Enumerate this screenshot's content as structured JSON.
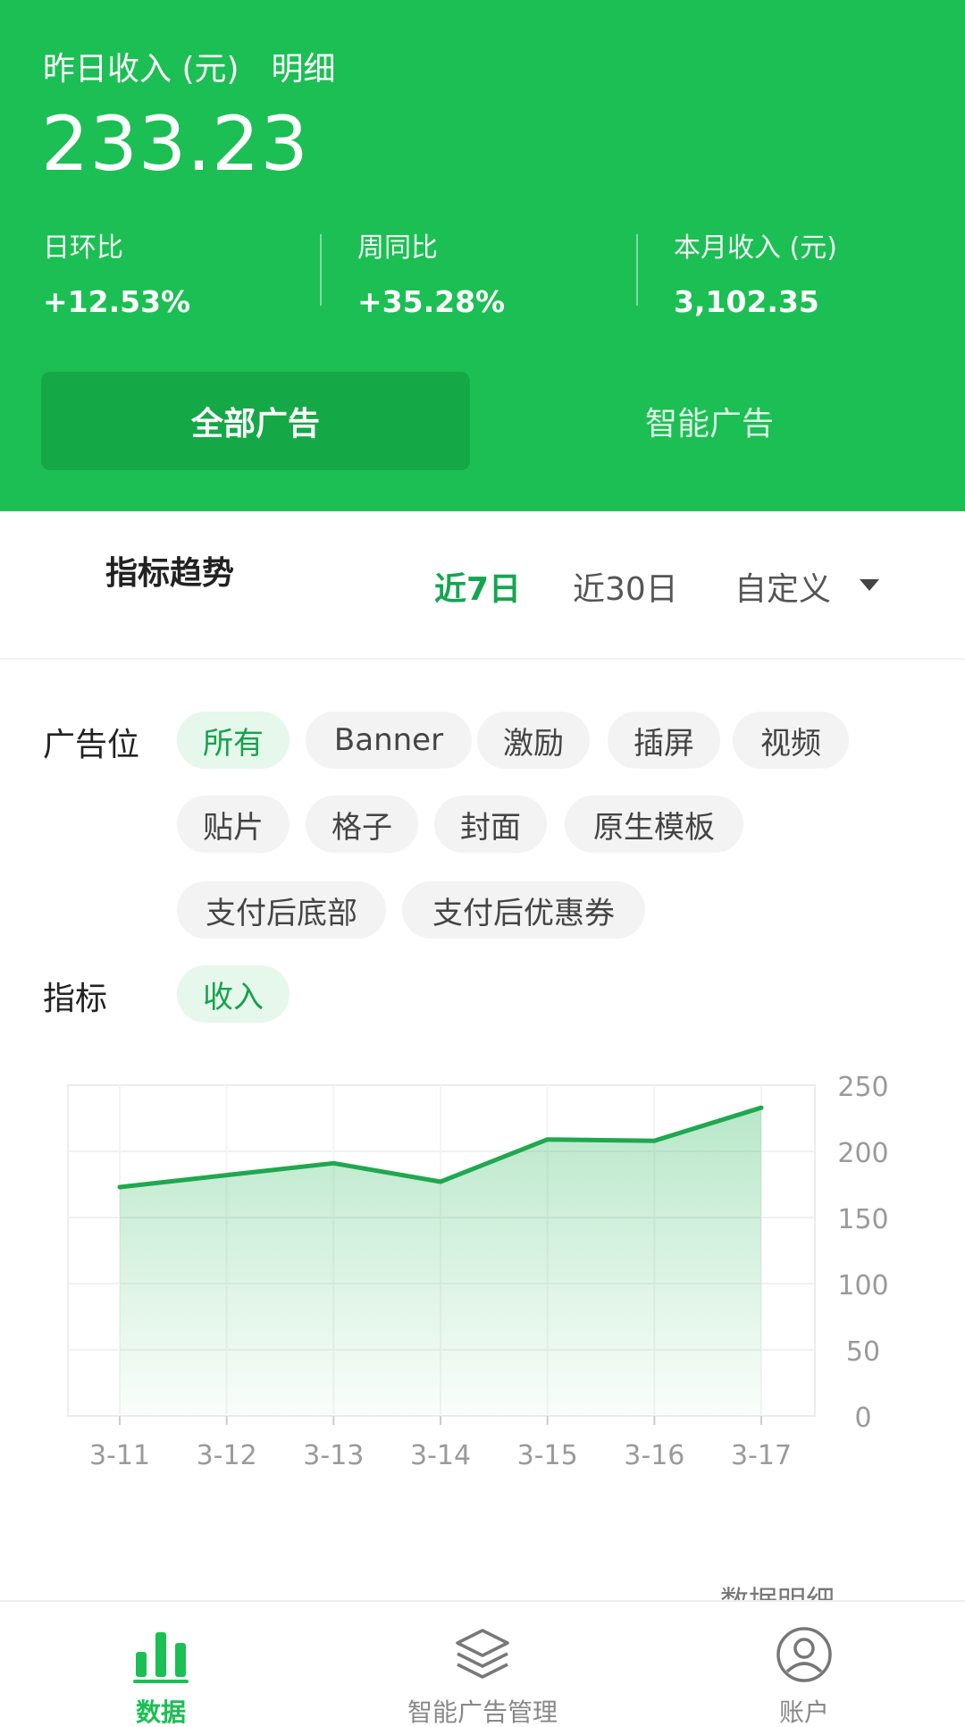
{
  "header": {
    "title": "昨日收入 (元)",
    "detail_link": "明细",
    "amount": "233.23",
    "stats": [
      {
        "label": "日环比",
        "value": "+12.53%"
      },
      {
        "label": "周同比",
        "value": "+35.28%"
      },
      {
        "label": "本月收入 (元)",
        "value": "3,102.35"
      }
    ],
    "segments": [
      {
        "label": "全部广告",
        "active": true
      },
      {
        "label": "智能广告",
        "active": false
      }
    ]
  },
  "trend": {
    "title": "指标趋势",
    "ranges": [
      {
        "label": "近7日",
        "active": true
      },
      {
        "label": "近30日",
        "active": false
      },
      {
        "label": "自定义",
        "active": false
      }
    ]
  },
  "filters": {
    "slot_label": "广告位",
    "slots": [
      {
        "label": "所有",
        "selected": true
      },
      {
        "label": "Banner",
        "selected": false
      },
      {
        "label": "激励",
        "selected": false
      },
      {
        "label": "插屏",
        "selected": false
      },
      {
        "label": "视频",
        "selected": false
      },
      {
        "label": "贴片",
        "selected": false
      },
      {
        "label": "格子",
        "selected": false
      },
      {
        "label": "封面",
        "selected": false
      },
      {
        "label": "原生模板",
        "selected": false
      },
      {
        "label": "支付后底部",
        "selected": false
      },
      {
        "label": "支付后优惠券",
        "selected": false
      }
    ],
    "metric_label": "指标",
    "metrics": [
      {
        "label": "收入",
        "selected": true
      }
    ]
  },
  "chart_data": {
    "type": "area",
    "categories": [
      "3-11",
      "3-12",
      "3-13",
      "3-14",
      "3-15",
      "3-16",
      "3-17"
    ],
    "series": [
      {
        "values": [
          173,
          182,
          191,
          177,
          209,
          208,
          233
        ]
      }
    ],
    "yticks": [
      "0",
      "50",
      "100",
      "150",
      "200",
      "250"
    ],
    "ylim": [
      0,
      250
    ],
    "y_axis_position": "right",
    "grid": true,
    "line_color": "#1fa84f"
  },
  "footer_link": "数据明细",
  "tabbar": [
    {
      "label": "数据",
      "icon": "bar-chart-icon",
      "active": true
    },
    {
      "label": "智能广告管理",
      "icon": "layers-icon",
      "active": false
    },
    {
      "label": "账户",
      "icon": "user-circle-icon",
      "active": false
    }
  ],
  "colors": {
    "brand_green": "#1bbf53",
    "active_text": "#13a650"
  }
}
